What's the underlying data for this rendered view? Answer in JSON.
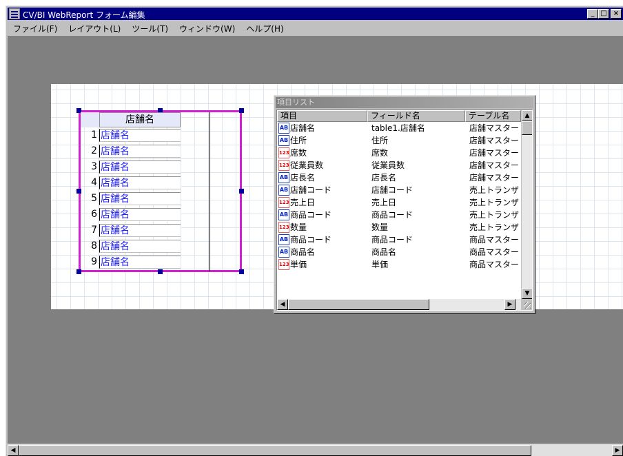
{
  "window": {
    "title": "CV/BI WebReport フォーム編集",
    "min": "_",
    "max": "□",
    "close": "×"
  },
  "menu": [
    "ファイル(F)",
    "レイアウト(L)",
    "ツール(T)",
    "ウィンドウ(W)",
    "ヘルプ(H)"
  ],
  "report": {
    "header": "店舗名",
    "rows": [
      {
        "num": "1",
        "value": "店舗名"
      },
      {
        "num": "2",
        "value": "店舗名"
      },
      {
        "num": "3",
        "value": "店舗名"
      },
      {
        "num": "4",
        "value": "店舗名"
      },
      {
        "num": "5",
        "value": "店舗名"
      },
      {
        "num": "6",
        "value": "店舗名"
      },
      {
        "num": "7",
        "value": "店舗名"
      },
      {
        "num": "8",
        "value": "店舗名"
      },
      {
        "num": "9",
        "value": "店舗名"
      }
    ]
  },
  "palette": {
    "title": "項目リスト",
    "columns": [
      "項目",
      "フィールド名",
      "テーブル名"
    ],
    "items": [
      {
        "icon": "text",
        "icon_text": "AB",
        "name": "店舗名",
        "field": "table1.店舗名",
        "table": "店舗マスター"
      },
      {
        "icon": "text",
        "icon_text": "AB",
        "name": "住所",
        "field": "住所",
        "table": "店舗マスター"
      },
      {
        "icon": "num",
        "icon_text": "123",
        "name": "席数",
        "field": "席数",
        "table": "店舗マスター"
      },
      {
        "icon": "num",
        "icon_text": "123",
        "name": "従業員数",
        "field": "従業員数",
        "table": "店舗マスター"
      },
      {
        "icon": "text",
        "icon_text": "AB",
        "name": "店長名",
        "field": "店長名",
        "table": "店舗マスター"
      },
      {
        "icon": "text",
        "icon_text": "AB",
        "name": "店舗コード",
        "field": "店舗コード",
        "table": "売上トランザ"
      },
      {
        "icon": "num",
        "icon_text": "123",
        "name": "売上日",
        "field": "売上日",
        "table": "売上トランザ"
      },
      {
        "icon": "text",
        "icon_text": "AB",
        "name": "商品コード",
        "field": "商品コード",
        "table": "売上トランザ"
      },
      {
        "icon": "num",
        "icon_text": "123",
        "name": "数量",
        "field": "数量",
        "table": "売上トランザ"
      },
      {
        "icon": "text",
        "icon_text": "AB",
        "name": "商品コード",
        "field": "商品コード",
        "table": "商品マスター"
      },
      {
        "icon": "text",
        "icon_text": "AB",
        "name": "商品名",
        "field": "商品名",
        "table": "商品マスター"
      },
      {
        "icon": "num",
        "icon_text": "123",
        "name": "単価",
        "field": "単価",
        "table": "商品マスター"
      }
    ]
  },
  "icons": {
    "scroll_up": "▲",
    "scroll_down": "▼",
    "scroll_left": "◀",
    "scroll_right": "▶",
    "text_field": "text-field-icon",
    "numeric_field": "numeric-field-icon"
  }
}
